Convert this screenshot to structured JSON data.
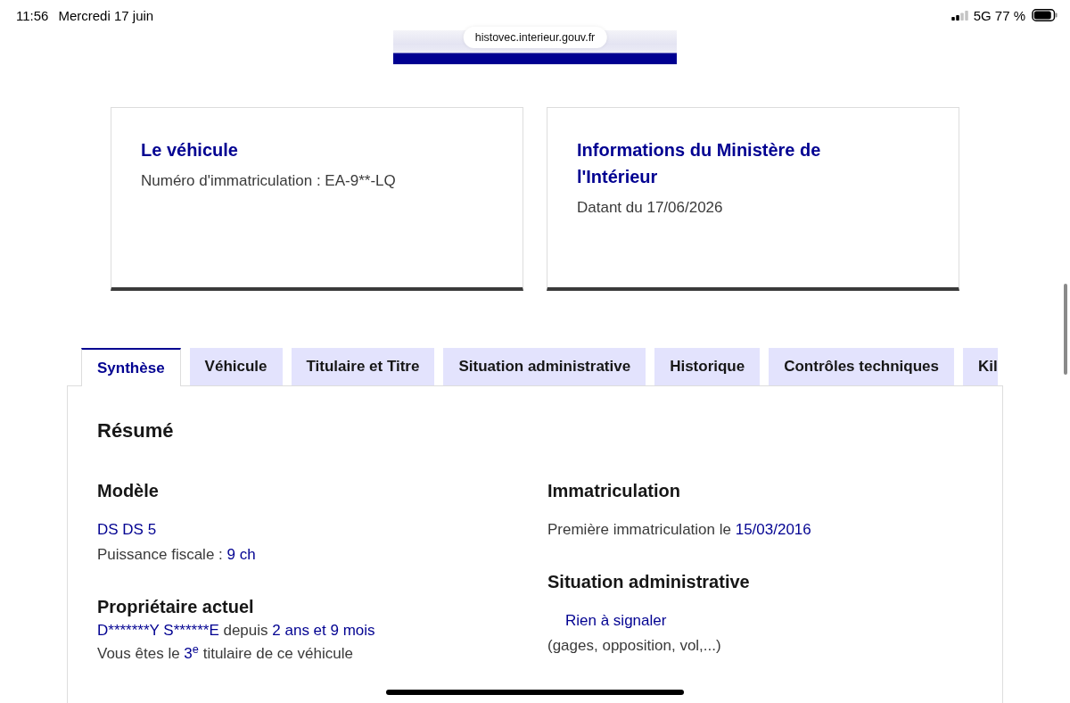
{
  "status_bar": {
    "time": "11:56",
    "date": "Mercredi 17 juin",
    "network": "5G",
    "battery": "77 %"
  },
  "browser": {
    "url": "histovec.interieur.gouv.fr"
  },
  "cards": [
    {
      "title": "Le véhicule",
      "text": "Numéro d'immatriculation : EA-9**-LQ"
    },
    {
      "title": "Informations du Ministère de l'Intérieur",
      "text": "Datant du 17/06/2026"
    }
  ],
  "tabs": [
    {
      "label": "Synthèse",
      "selected": true
    },
    {
      "label": "Véhicule",
      "selected": false
    },
    {
      "label": "Titulaire et Titre",
      "selected": false
    },
    {
      "label": "Situation administrative",
      "selected": false
    },
    {
      "label": "Historique",
      "selected": false
    },
    {
      "label": "Contrôles techniques",
      "selected": false
    },
    {
      "label": "Kil",
      "selected": false
    }
  ],
  "panel": {
    "title": "Résumé",
    "columns": [
      [
        {
          "heading": "Modèle",
          "lines": [
            {
              "kind": "text",
              "parts": [
                {
                  "text": "DS DS 5",
                  "kind": "value"
                }
              ]
            },
            {
              "kind": "text",
              "parts": [
                {
                  "text": "Puissance fiscale :",
                  "kind": "plain"
                },
                {
                  "text": "9 ch",
                  "kind": "value"
                }
              ]
            }
          ]
        },
        {
          "heading": "Propriétaire actuel",
          "lines": [
            {
              "kind": "text",
              "parts": [
                {
                  "text": "D*******Y S******E",
                  "kind": "value"
                },
                {
                  "text": "depuis",
                  "kind": "plain"
                },
                {
                  "text": "2 ans et 9 mois",
                  "kind": "value"
                }
              ]
            },
            {
              "kind": "text",
              "parts": [
                {
                  "text": "Vous êtes le",
                  "kind": "plain"
                },
                {
                  "text": "3$^{e}$",
                  "kind": "ordinal"
                },
                {
                  "text": "titulaire de ce véhicule",
                  "kind": "plain"
                }
              ]
            }
          ]
        }
      ],
      [
        {
          "heading": "Immatriculation",
          "lines": [
            {
              "kind": "text",
              "parts": [
                {
                  "text": "Première immatriculation le",
                  "kind": "plain"
                },
                {
                  "text": "15/03/2016",
                  "kind": "value"
                }
              ]
            }
          ]
        },
        {
          "heading": "Situation administrative",
          "lines": [
            {
              "kind": "status",
              "parts": [
                {
                  "text": "Rien à signaler",
                  "kind": "value"
                }
              ]
            },
            {
              "kind": "text",
              "parts": [
                {
                  "text": "(gages, opposition, vol,...)",
                  "kind": "plain"
                }
              ]
            }
          ]
        }
      ]
    ]
  }
}
